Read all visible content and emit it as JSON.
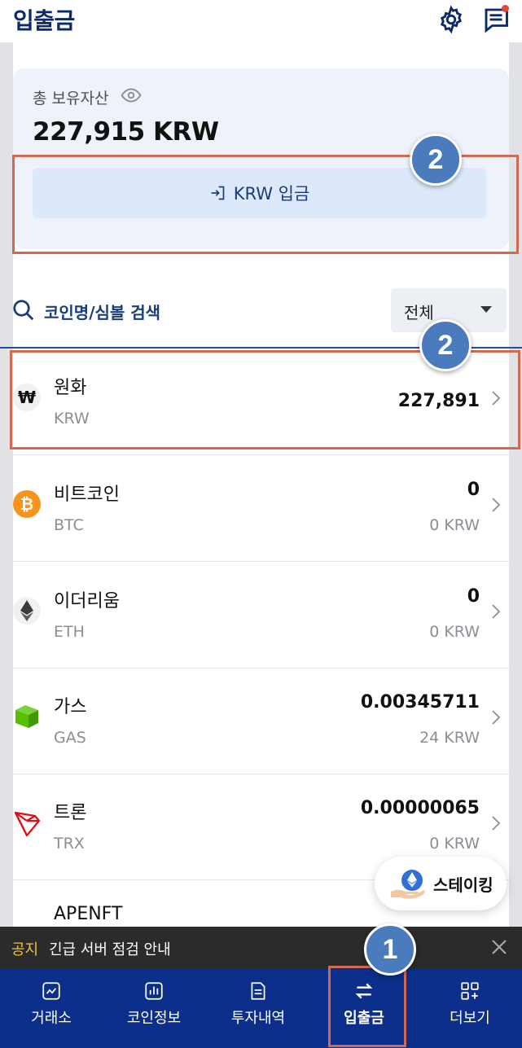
{
  "header": {
    "title": "입출금"
  },
  "asset": {
    "label": "총 보유자산",
    "value": "227,915 KRW",
    "deposit_button": "KRW 입금"
  },
  "search": {
    "placeholder": "코인명/심볼 검색"
  },
  "filter": {
    "selected": "전체"
  },
  "coins": [
    {
      "name": "원화",
      "symbol": "KRW",
      "amount": "227,891",
      "krw": "",
      "icon": "won-icon",
      "color": "#1a1a1a"
    },
    {
      "name": "비트코인",
      "symbol": "BTC",
      "amount": "0",
      "krw": "0 KRW",
      "icon": "bitcoin-icon",
      "color": "#f7931a"
    },
    {
      "name": "이더리움",
      "symbol": "ETH",
      "amount": "0",
      "krw": "0 KRW",
      "icon": "ethereum-icon",
      "color": "#3c3c3d"
    },
    {
      "name": "가스",
      "symbol": "GAS",
      "amount": "0.00345711",
      "krw": "24 KRW",
      "icon": "gas-icon",
      "color": "#58bf00"
    },
    {
      "name": "트론",
      "symbol": "TRX",
      "amount": "0.00000065",
      "krw": "0 KRW",
      "icon": "tron-icon",
      "color": "#e50915"
    },
    {
      "name": "APENFT",
      "symbol": "",
      "amount": "",
      "krw": "",
      "icon": "",
      "color": ""
    }
  ],
  "staking": {
    "label": "스테이킹"
  },
  "notice": {
    "tag": "공지",
    "text": "긴급 서버 점검 안내"
  },
  "tabs": [
    {
      "label": "거래소",
      "icon": "chart-trend-icon"
    },
    {
      "label": "코인정보",
      "icon": "bar-chart-icon"
    },
    {
      "label": "투자내역",
      "icon": "document-icon"
    },
    {
      "label": "입출금",
      "icon": "transfer-icon",
      "active": true
    },
    {
      "label": "더보기",
      "icon": "grid-plus-icon"
    }
  ],
  "annotations": [
    "1",
    "2",
    "2"
  ]
}
